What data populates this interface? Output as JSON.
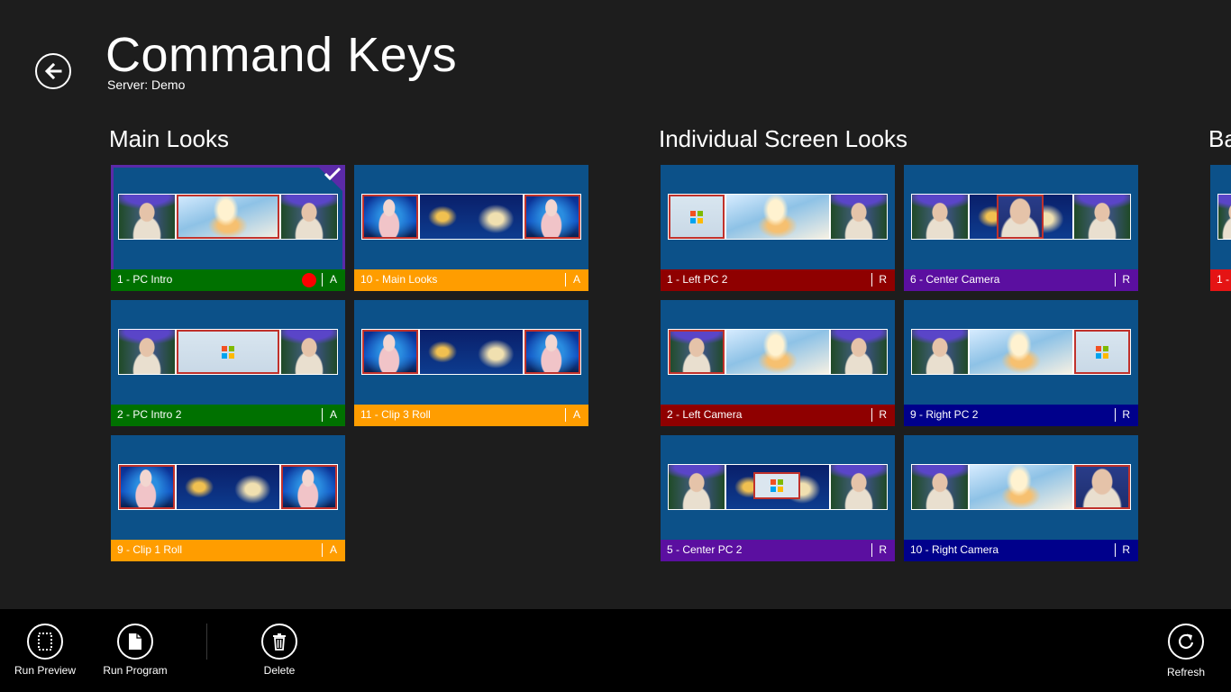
{
  "header": {
    "title": "Command Keys",
    "subtitle": "Server: Demo"
  },
  "groups": [
    {
      "title": "Main Looks",
      "tiles": [
        {
          "label": "1 - PC Intro",
          "code": "A",
          "color": "#007100",
          "selected": true,
          "recording": true
        },
        {
          "label": "2 - PC Intro 2",
          "code": "A",
          "color": "#007100"
        },
        {
          "label": "9 - Clip 1 Roll",
          "code": "A",
          "color": "#ff9d00"
        },
        {
          "label": "10 - Main Looks",
          "code": "A",
          "color": "#ff9d00"
        },
        {
          "label": "11 - Clip 3 Roll",
          "code": "A",
          "color": "#ff9d00"
        }
      ]
    },
    {
      "title": "Individual Screen Looks",
      "tiles": [
        {
          "label": "1 - Left PC 2",
          "code": "R",
          "color": "#8f0000"
        },
        {
          "label": "2 - Left Camera",
          "code": "R",
          "color": "#8f0000"
        },
        {
          "label": "5 - Center PC 2",
          "code": "R",
          "color": "#5b0fa0"
        },
        {
          "label": "6 - Center Camera",
          "code": "R",
          "color": "#5b0fa0"
        },
        {
          "label": "9 - Right PC 2",
          "code": "R",
          "color": "#00008b"
        },
        {
          "label": "10 - Right Camera",
          "code": "R",
          "color": "#00008b"
        }
      ]
    },
    {
      "title": "Ba",
      "tiles": [
        {
          "label": "1 -",
          "color": "#e51414"
        }
      ]
    }
  ],
  "appbar": {
    "run_preview": "Run Preview",
    "run_program": "Run Program",
    "delete": "Delete",
    "refresh": "Refresh"
  },
  "icons": {
    "back": "back-arrow-icon",
    "selected": "checkmark-icon",
    "run_preview": "dotted-page-icon",
    "run_program": "page-icon",
    "delete": "trash-icon",
    "refresh": "refresh-icon"
  }
}
